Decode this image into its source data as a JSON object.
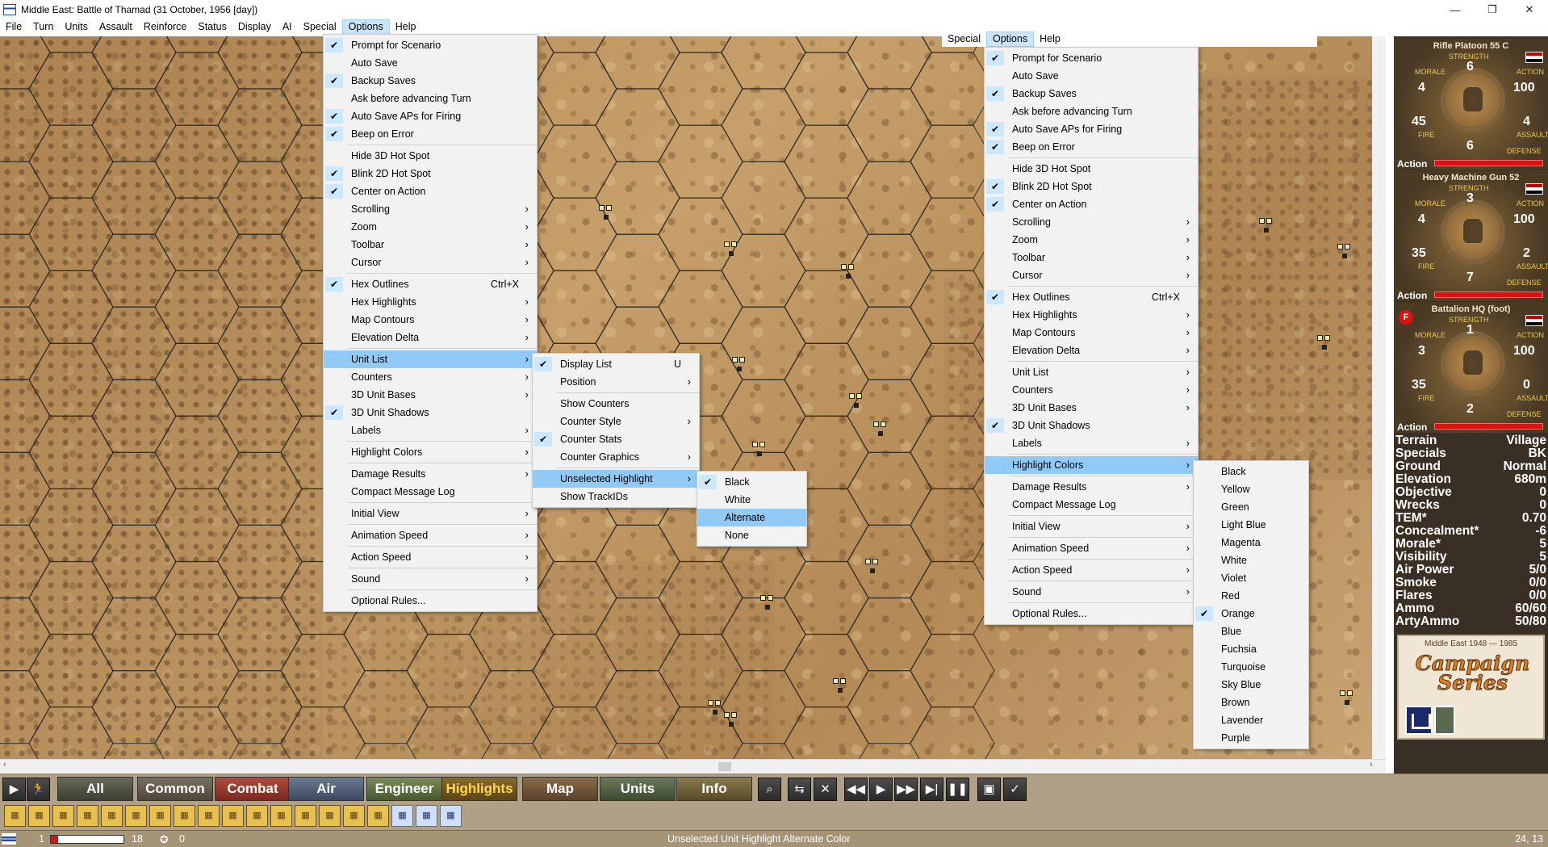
{
  "window": {
    "title": "Middle East: Battle of Thamad (31 October, 1956 [day])",
    "controls": {
      "minimize": "—",
      "maximize": "❐",
      "close": "✕"
    }
  },
  "menubar": [
    "File",
    "Turn",
    "Units",
    "Assault",
    "Reinforce",
    "Status",
    "Display",
    "AI",
    "Special",
    "Options",
    "Help"
  ],
  "menubar_active": "Options",
  "menubar2": [
    "Special",
    "Options",
    "Help"
  ],
  "options_menu": [
    {
      "label": "Prompt for Scenario",
      "checked": true
    },
    {
      "label": "Auto Save"
    },
    {
      "label": "Backup Saves",
      "checked": true
    },
    {
      "label": "Ask before advancing Turn"
    },
    {
      "label": "Auto Save APs for Firing",
      "checked": true
    },
    {
      "label": "Beep on Error",
      "checked": true
    },
    {
      "sep": true
    },
    {
      "label": "Hide 3D Hot Spot"
    },
    {
      "label": "Blink 2D Hot Spot",
      "checked": true
    },
    {
      "label": "Center on Action",
      "checked": true
    },
    {
      "label": "Scrolling",
      "submenu": true
    },
    {
      "label": "Zoom",
      "submenu": true
    },
    {
      "label": "Toolbar",
      "submenu": true
    },
    {
      "label": "Cursor",
      "submenu": true
    },
    {
      "sep": true
    },
    {
      "label": "Hex Outlines",
      "checked": true,
      "shortcut": "Ctrl+X"
    },
    {
      "label": "Hex Highlights",
      "submenu": true
    },
    {
      "label": "Map Contours",
      "submenu": true
    },
    {
      "label": "Elevation Delta",
      "submenu": true
    },
    {
      "sep": true
    },
    {
      "label": "Unit List",
      "submenu": true
    },
    {
      "label": "Counters",
      "submenu": true
    },
    {
      "label": "3D Unit Bases",
      "submenu": true
    },
    {
      "label": "3D Unit Shadows",
      "checked": true
    },
    {
      "label": "Labels",
      "submenu": true
    },
    {
      "sep": true
    },
    {
      "label": "Highlight Colors",
      "submenu": true
    },
    {
      "sep": true
    },
    {
      "label": "Damage Results",
      "submenu": true
    },
    {
      "label": "Compact Message Log"
    },
    {
      "sep": true
    },
    {
      "label": "Initial View",
      "submenu": true
    },
    {
      "sep": true
    },
    {
      "label": "Animation Speed",
      "submenu": true
    },
    {
      "sep": true
    },
    {
      "label": "Action Speed",
      "submenu": true
    },
    {
      "sep": true
    },
    {
      "label": "Sound",
      "submenu": true
    },
    {
      "sep": true
    },
    {
      "label": "Optional Rules..."
    }
  ],
  "unit_list_menu": [
    {
      "label": "Display List",
      "checked": true,
      "shortcut": "U"
    },
    {
      "label": "Position",
      "submenu": true
    },
    {
      "sep": true
    },
    {
      "label": "Show Counters"
    },
    {
      "label": "Counter Style",
      "submenu": true
    },
    {
      "label": "Counter Stats",
      "checked": true
    },
    {
      "label": "Counter Graphics",
      "submenu": true
    },
    {
      "sep": true
    },
    {
      "label": "Unselected Highlight",
      "submenu": true
    },
    {
      "label": "Show TrackIDs"
    }
  ],
  "unselected_highlight_menu": [
    {
      "label": "Black",
      "checked": true
    },
    {
      "label": "White"
    },
    {
      "label": "Alternate"
    },
    {
      "label": "None"
    }
  ],
  "highlight_colors_menu": [
    {
      "label": "Black"
    },
    {
      "label": "Yellow"
    },
    {
      "label": "Green"
    },
    {
      "label": "Light Blue"
    },
    {
      "label": "Magenta"
    },
    {
      "label": "White"
    },
    {
      "label": "Violet"
    },
    {
      "label": "Red"
    },
    {
      "label": "Orange",
      "checked": true
    },
    {
      "label": "Blue"
    },
    {
      "label": "Fuchsia"
    },
    {
      "label": "Turquoise"
    },
    {
      "label": "Sky Blue"
    },
    {
      "label": "Brown"
    },
    {
      "label": "Lavender"
    },
    {
      "label": "Purple"
    }
  ],
  "glyphs": {
    "check": "✔",
    "arrow": "›"
  },
  "unit_cards": [
    {
      "name": "Rifle Platoon 55 C",
      "strength": "6",
      "morale": "4",
      "action": "100",
      "fire": "45",
      "assault": "4",
      "defense": "6",
      "steps": "6",
      "fire_flag": false
    },
    {
      "name": "Heavy Machine Gun 52",
      "strength": "3",
      "morale": "4",
      "action": "100",
      "fire": "35",
      "assault": "2",
      "defense": "7",
      "steps": "3",
      "fire_flag": false
    },
    {
      "name": "Battalion HQ (foot)",
      "strength": "1",
      "morale": "3",
      "action": "100",
      "fire": "35",
      "assault": "0",
      "defense": "2",
      "steps": "1",
      "fire_flag": true
    }
  ],
  "card_labels": {
    "strength": "STRENGTH",
    "morale": "MORALE",
    "action": "ACTION",
    "fire": "FIRE",
    "assault": "ASSAULT",
    "defense": "DEFENSE",
    "action_bar": "Action",
    "fire_badge": "F"
  },
  "terrain": [
    {
      "k": "Terrain",
      "v": "Village"
    },
    {
      "k": "Specials",
      "v": "BK"
    },
    {
      "k": "Ground",
      "v": "Normal"
    },
    {
      "k": "Elevation",
      "v": "680m"
    },
    {
      "k": "Objective",
      "v": "0"
    },
    {
      "k": "Wrecks",
      "v": "0"
    },
    {
      "k": "TEM*",
      "v": "0.70"
    },
    {
      "k": "Concealment*",
      "v": "-6"
    },
    {
      "k": "Morale*",
      "v": "5"
    },
    {
      "k": "Visibility",
      "v": "5"
    },
    {
      "k": "Air Power",
      "v": "5/0"
    },
    {
      "k": "Smoke",
      "v": "0/0"
    },
    {
      "k": "Flares",
      "v": "0/0"
    },
    {
      "k": "Ammo",
      "v": "60/60"
    },
    {
      "k": "ArtyAmmo",
      "v": "50/80"
    }
  ],
  "logo": {
    "top": "Middle East 1948 — 1985",
    "title": "Campaign Series"
  },
  "toolbar_tabs": [
    "All",
    "Common",
    "Combat",
    "Air",
    "Engineer",
    "Highlights",
    "Map",
    "Units",
    "Info"
  ],
  "toolbar_icons": [
    "play-icon",
    "run-icon",
    "magnifier-icon",
    "swap-icon",
    "cancel-icon",
    "rewind-icon",
    "play-icon",
    "fast-forward-icon",
    "skip-end-icon",
    "pause-icon",
    "save-icon",
    "check-icon"
  ],
  "toolbar2_icons": 19,
  "status": {
    "turn": "1",
    "progress": 0.1,
    "max_turns": "18",
    "vp": "0",
    "message": "Unselected Unit Highlight Alternate Color",
    "coords": "24, 13"
  }
}
